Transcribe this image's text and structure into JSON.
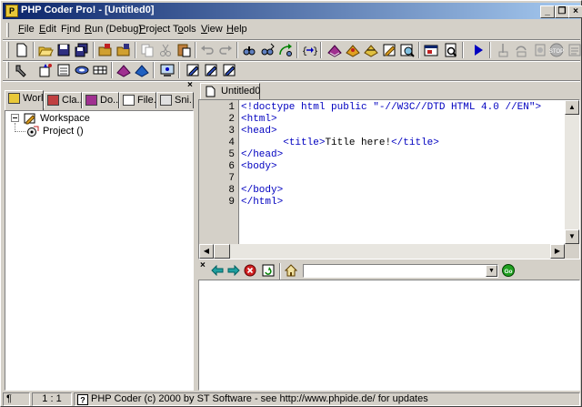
{
  "window": {
    "title": "PHP Coder Pro! - [Untitled0]",
    "app_icon": "php-coder-icon"
  },
  "caption_buttons": {
    "minimize": "_",
    "restore": "❐",
    "close": "×"
  },
  "menubar": {
    "items": [
      {
        "label": "File",
        "key": "F"
      },
      {
        "label": "Edit",
        "key": "E"
      },
      {
        "label": "Find",
        "key": "i"
      },
      {
        "label": "Run (Debug)",
        "key": "R"
      },
      {
        "label": "Project",
        "key": "P"
      },
      {
        "label": "Tools",
        "key": "o"
      },
      {
        "label": "View",
        "key": "V"
      },
      {
        "label": "Help",
        "key": "H"
      }
    ]
  },
  "left_panel": {
    "tabs": [
      {
        "label": "Worl...",
        "icon": "workspace-icon"
      },
      {
        "label": "Cla...",
        "icon": "class-icon"
      },
      {
        "label": "Do...",
        "icon": "documents-icon"
      },
      {
        "label": "File...",
        "icon": "files-icon"
      },
      {
        "label": "Sni...",
        "icon": "snippets-icon"
      }
    ],
    "tree": {
      "root": "Workspace",
      "child": "Project ()"
    }
  },
  "editor": {
    "tab_label": "Untitled0",
    "lines": [
      {
        "n": "1",
        "code": "<!doctype html public \"-//W3C//DTD HTML 4.0 //EN\">"
      },
      {
        "n": "2",
        "code": "<html>"
      },
      {
        "n": "3",
        "code": "<head>"
      },
      {
        "n": "4",
        "indent": "       ",
        "pre": "<title>",
        "text": "Title here!",
        "post": "</title>"
      },
      {
        "n": "5",
        "code": "</head>"
      },
      {
        "n": "6",
        "code": "<body>"
      },
      {
        "n": "7",
        "code": ""
      },
      {
        "n": "8",
        "code": "</body>"
      },
      {
        "n": "9",
        "code": "</html>"
      }
    ]
  },
  "output_toolbar": {
    "combo_value": "",
    "go_label": "Go"
  },
  "statusbar": {
    "marker": "¶",
    "position": "1 : 1",
    "message": "PHP Coder (c) 2000 by ST Software - see http://www.phpide.de/ for updates"
  },
  "colors": {
    "title_start": "#0a246a",
    "title_end": "#a6caf0",
    "code_tag": "#0000c0",
    "face": "#d4d0c8"
  }
}
